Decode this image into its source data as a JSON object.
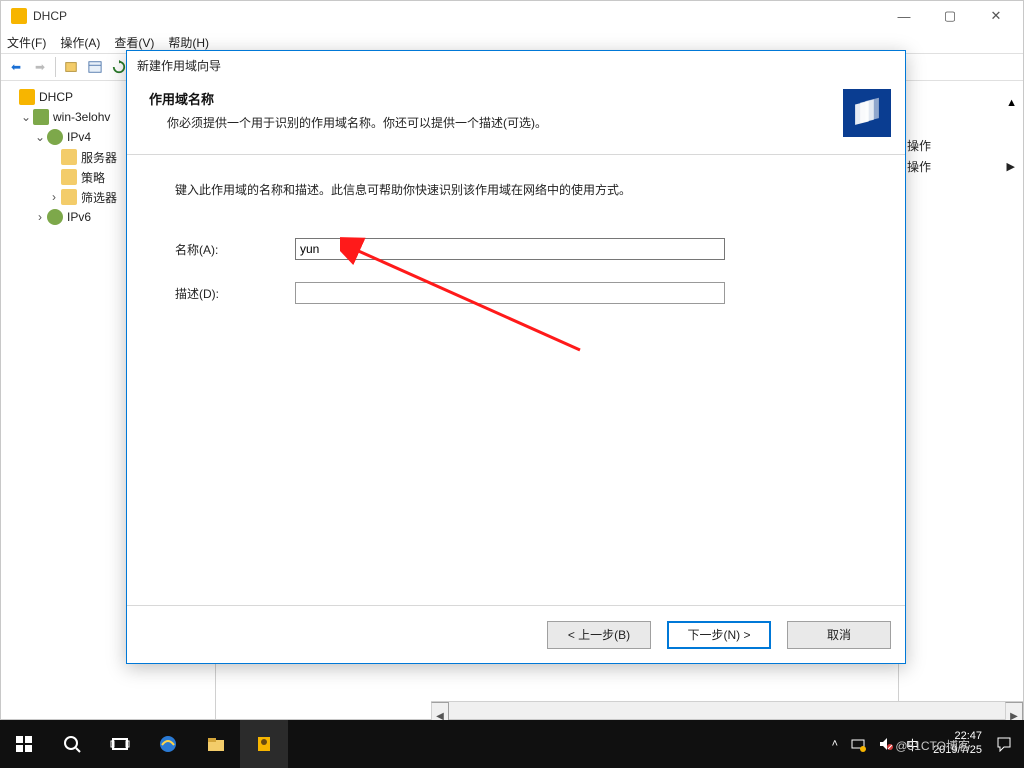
{
  "window": {
    "title": "DHCP",
    "menus": {
      "file": "文件(F)",
      "action": "操作(A)",
      "view": "查看(V)",
      "help": "帮助(H)"
    }
  },
  "tree": {
    "root": "DHCP",
    "server": "win-3elohv",
    "ipv4": "IPv4",
    "ipv4_items": {
      "server_opts": "服务器",
      "policies": "策略",
      "filters": "筛选器"
    },
    "ipv6": "IPv6"
  },
  "actions_pane": {
    "header": "操作",
    "operate": "操作"
  },
  "wizard": {
    "title": "新建作用域向导",
    "h1": "作用域名称",
    "h2": "你必须提供一个用于识别的作用域名称。你还可以提供一个描述(可选)。",
    "instruction": "键入此作用域的名称和描述。此信息可帮助你快速识别该作用域在网络中的使用方式。",
    "name_label": "名称(A):",
    "name_value": "yun",
    "desc_label": "描述(D):",
    "desc_value": "",
    "buttons": {
      "back": "< 上一步(B)",
      "next": "下一步(N) >",
      "cancel": "取消"
    }
  },
  "taskbar": {
    "ime": "中",
    "time": "22:47",
    "date": "2019/7/25"
  },
  "watermark": "@51CTO博客"
}
